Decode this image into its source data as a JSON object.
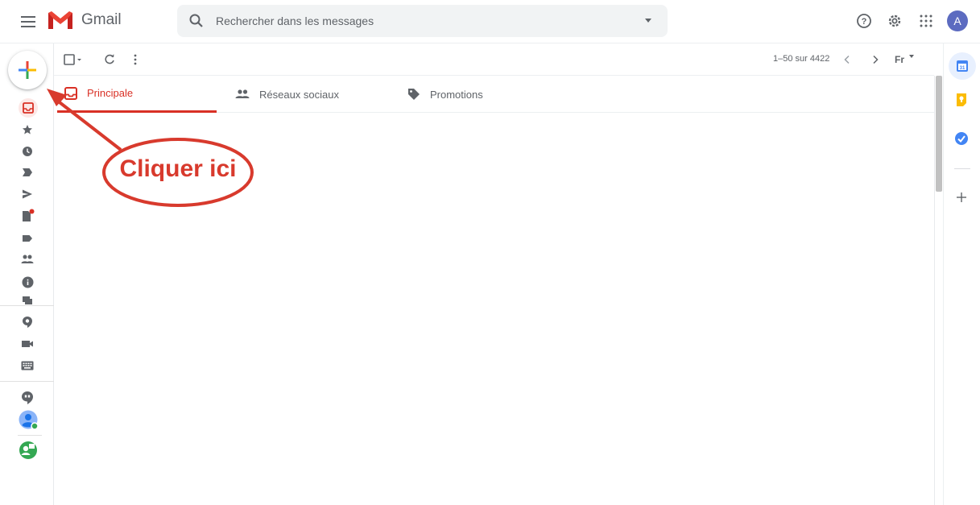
{
  "app": {
    "name": "Gmail"
  },
  "search": {
    "placeholder": "Rechercher dans les messages"
  },
  "toolbar": {
    "page_info": "1–50 sur 4422",
    "language": "Fr"
  },
  "tabs": [
    {
      "label": "Principale",
      "active": true
    },
    {
      "label": "Réseaux sociaux",
      "active": false
    },
    {
      "label": "Promotions",
      "active": false
    }
  ],
  "user": {
    "avatar_letter": "A",
    "avatar_color": "#5c6bc0"
  },
  "left_nav": {
    "icons": [
      "inbox-icon",
      "star-icon",
      "clock-icon",
      "important-icon",
      "send-icon",
      "draft-icon",
      "label-icon",
      "people-icon",
      "info-icon",
      "forum-icon",
      "hangouts-bubble-icon",
      "video-icon",
      "keyboard-icon",
      "hangouts-icon",
      "contact-avatar-icon",
      "hangouts-user-icon"
    ]
  },
  "annotation": {
    "text": "Cliquer ici",
    "color": "#d83a2d"
  },
  "colors": {
    "accent_red": "#d93025",
    "text_grey": "#5f6368",
    "search_bg": "#f1f3f4"
  }
}
